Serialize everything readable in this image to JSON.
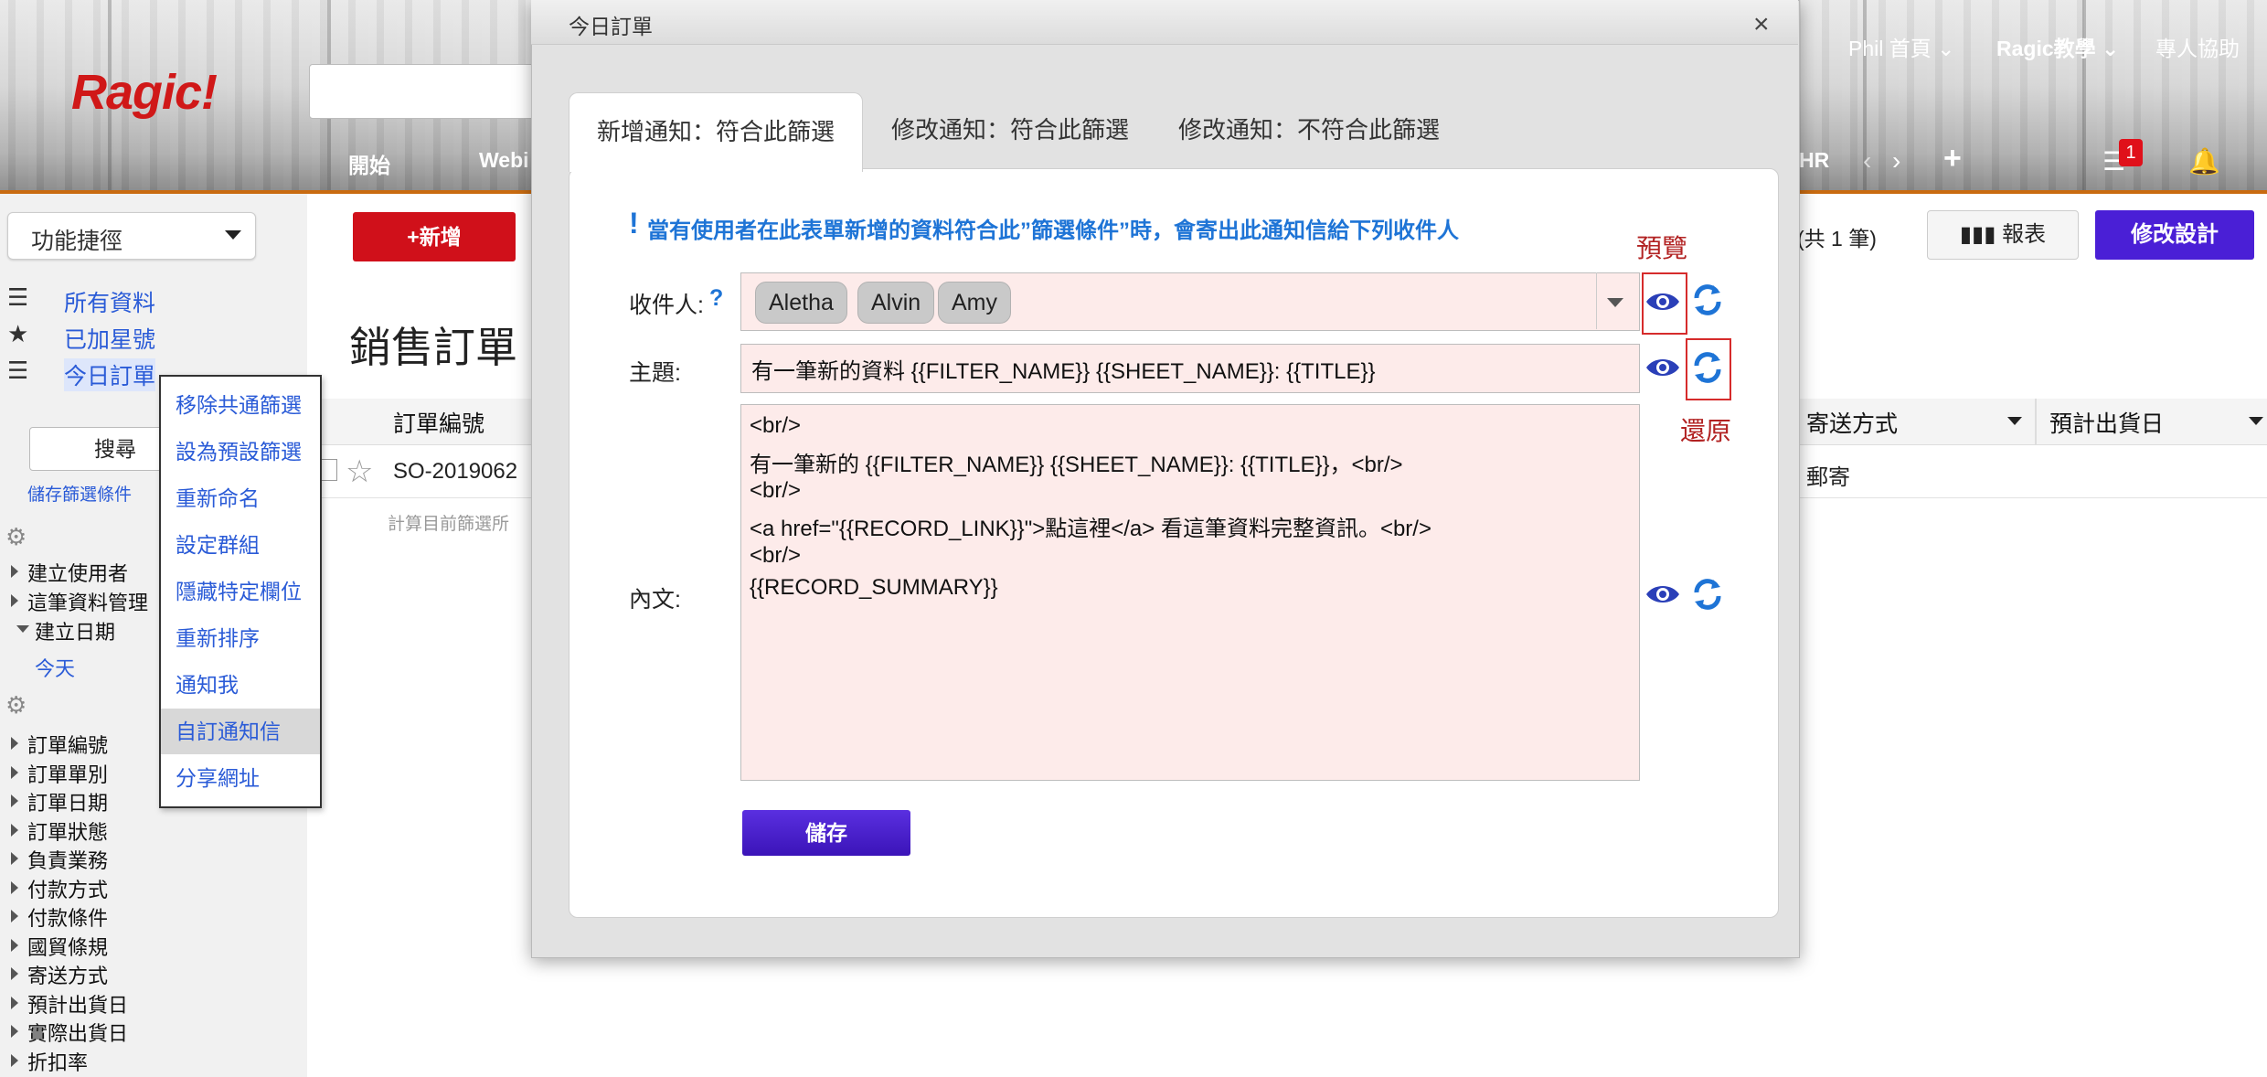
{
  "app": {
    "logo": "Ragic!"
  },
  "topnav": {
    "home": "Phil 首頁",
    "tutorial": "Ragic教學",
    "help": "專人協助",
    "badge_count": "1"
  },
  "navtabs": [
    "開始",
    "Webi",
    "HR"
  ],
  "sidebar": {
    "shortcut_label": "功能捷徑",
    "views": [
      "所有資料",
      "已加星號",
      "今日訂單"
    ],
    "search_button": "搜尋",
    "save_filter": "儲存篩選條件",
    "group1": [
      "建立使用者",
      "這筆資料管理",
      "建立日期"
    ],
    "date_value": "今天",
    "fields": [
      "訂單編號",
      "訂單單別",
      "訂單日期",
      "訂單狀態",
      "負責業務",
      "付款方式",
      "付款條件",
      "國貿條規",
      "寄送方式",
      "預計出貨日",
      "實際出貨日",
      "折扣率"
    ]
  },
  "context_menu": [
    "移除共通篩選",
    "設為預設篩選",
    "重新命名",
    "設定群組",
    "隱藏特定欄位",
    "重新排序",
    "通知我",
    "自訂通知信",
    "分享網址"
  ],
  "main": {
    "add_button": "+新增",
    "sheet_title": "銷售訂單",
    "total_count": "(共 1 筆)",
    "report_button": "報表",
    "design_button": "修改設計",
    "columns": [
      "訂單編號",
      "寄送方式",
      "預計出貨日"
    ],
    "row": {
      "id": "SO-2019062",
      "ship": "郵寄"
    },
    "calc_note": "計算目前篩選所"
  },
  "modal": {
    "title": "今日訂單",
    "tabs": [
      "新增通知：符合此篩選",
      "修改通知：符合此篩選",
      "修改通知：不符合此篩選"
    ],
    "notice": "當有使用者在此表單新增的資料符合此”篩選條件”時，會寄出此通知信給下列收件人",
    "recipient_label": "收件人:",
    "recipient_help": "?",
    "recipients": [
      "Aletha",
      "Alvin",
      "Amy"
    ],
    "subject_label": "主題:",
    "subject_value": "有一筆新的資料 {{FILTER_NAME}} {{SHEET_NAME}}: {{TITLE}}",
    "body_label": "內文:",
    "body_lines": [
      "<br/>",
      "有一筆新的 {{FILTER_NAME}} {{SHEET_NAME}}: {{TITLE}}，<br/>",
      "<br/>",
      "<a href=\"{{RECORD_LINK}}\">點這裡</a> 看這筆資料完整資訊。<br/>",
      "<br/>",
      "{{RECORD_SUMMARY}}"
    ],
    "preview_annotation": "預覽",
    "restore_annotation": "還原",
    "save_button": "儲存"
  },
  "colors": {
    "accent_blue": "#1e74d6",
    "save_purple": "#4a1fd6",
    "add_red": "#d0101a",
    "field_pink": "#fdebea",
    "annotation_red": "#b22222"
  }
}
